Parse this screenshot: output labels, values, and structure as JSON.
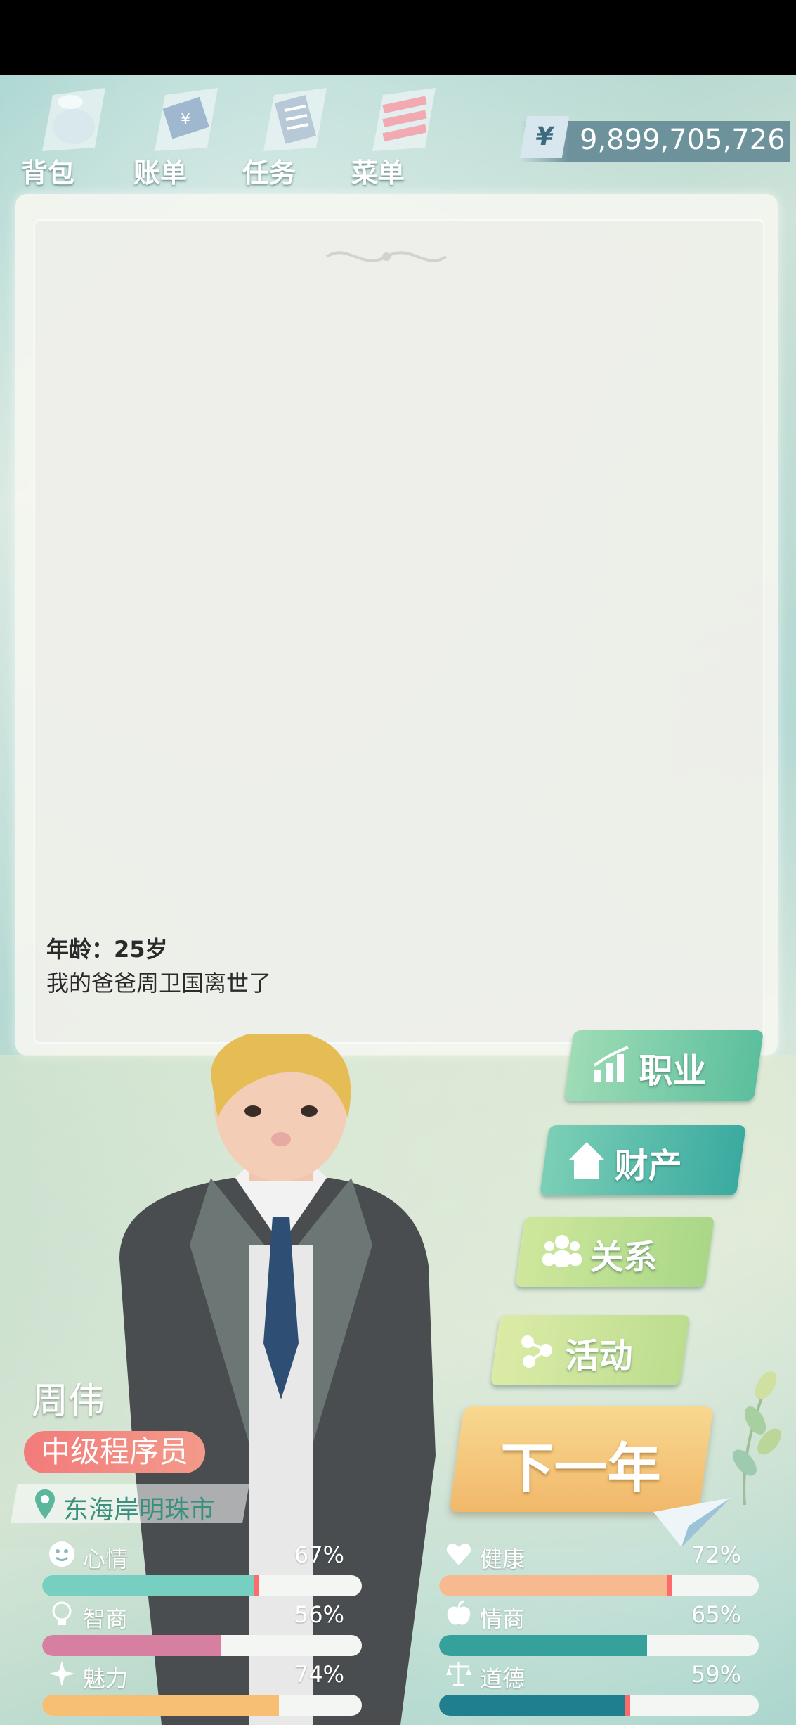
{
  "nav": [
    {
      "label": "背包",
      "icon": "bag-icon"
    },
    {
      "label": "账单",
      "icon": "bill-icon"
    },
    {
      "label": "任务",
      "icon": "task-list-icon"
    },
    {
      "label": "菜单",
      "icon": "menu-icon"
    }
  ],
  "money": {
    "symbol": "¥",
    "amount": "9,899,705,726"
  },
  "log": {
    "age": "年龄：25岁",
    "event": "我的爸爸周卫国离世了"
  },
  "actions": [
    {
      "label": "职业",
      "icon": "career-chart-icon",
      "color": "#5bbf9d"
    },
    {
      "label": "财产",
      "icon": "house-icon",
      "color": "#4fb6a6"
    },
    {
      "label": "关系",
      "icon": "people-icon",
      "color": "#b7d98a"
    },
    {
      "label": "活动",
      "icon": "activity-dots-icon",
      "color": "#c6de8e"
    }
  ],
  "next_year": {
    "label": "下一年"
  },
  "character": {
    "name": "周伟",
    "job": "中级程序员",
    "city": "东海岸明珠市"
  },
  "stats": [
    {
      "label": "心情",
      "value": "67%",
      "fraction": 0.67,
      "icon": "smiley-icon",
      "color": "#76cfc1",
      "marker": true
    },
    {
      "label": "健康",
      "value": "72%",
      "fraction": 0.72,
      "icon": "heart-icon",
      "color": "#f7b98f",
      "marker": true
    },
    {
      "label": "智商",
      "value": "56%",
      "fraction": 0.56,
      "icon": "lightbulb-icon",
      "color": "#d77fa0",
      "marker": false
    },
    {
      "label": "情商",
      "value": "65%",
      "fraction": 0.65,
      "icon": "apple-icon",
      "color": "#35a19a",
      "marker": false
    },
    {
      "label": "魅力",
      "value": "74%",
      "fraction": 0.74,
      "icon": "sparkle-icon",
      "color": "#f7bf74",
      "marker": false
    },
    {
      "label": "道德",
      "value": "59%",
      "fraction": 0.59,
      "icon": "scales-icon",
      "color": "#1f7f8f",
      "marker": true
    }
  ]
}
